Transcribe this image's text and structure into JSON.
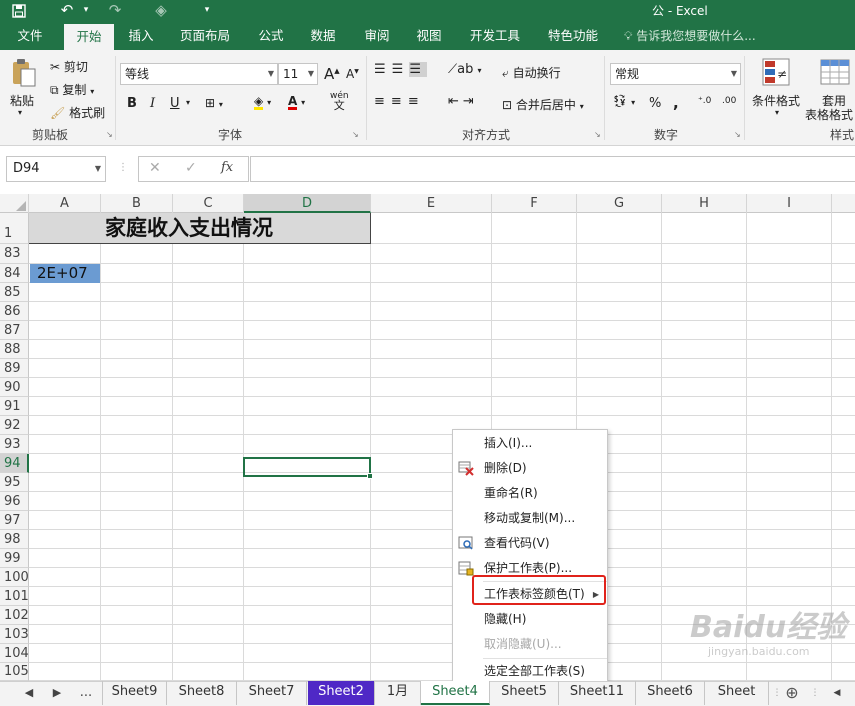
{
  "titlebar": {
    "title": "公 - Excel",
    "save_icon": "save-icon",
    "undo_icon": "undo-icon",
    "redo_icon": "redo-icon",
    "customize_icon": "customize-qat-icon"
  },
  "ribbon_tabs": [
    "文件",
    "开始",
    "插入",
    "页面布局",
    "公式",
    "数据",
    "审阅",
    "视图",
    "开发工具",
    "特色功能"
  ],
  "active_tab": "开始",
  "tell_me": "告诉我您想要做什么...",
  "clipboard": {
    "paste": "粘贴",
    "cut": "剪切",
    "copy": "复制",
    "format_painter": "格式刷",
    "label": "剪贴板"
  },
  "font": {
    "name": "等线",
    "size": "11",
    "label": "字体",
    "bold": "B",
    "italic": "I",
    "underline": "U",
    "grow": "A",
    "shrink": "A",
    "phonetic": "wén"
  },
  "alignment": {
    "wrap": "自动换行",
    "merge": "合并后居中",
    "label": "对齐方式"
  },
  "number": {
    "format": "常规",
    "label": "数字",
    "percent": "%",
    "comma": ","
  },
  "styles": {
    "conditional": "条件格式",
    "table1": "套用",
    "table2": "表格格式",
    "label": "样式"
  },
  "formula_bar": {
    "name_box": "D94",
    "cancel": "✕",
    "enter": "✓",
    "fx": "fx",
    "value": ""
  },
  "columns": [
    "A",
    "B",
    "C",
    "D",
    "E",
    "F",
    "G",
    "H",
    "I"
  ],
  "selected_column": "D",
  "rows": [
    "1",
    "83",
    "84",
    "85",
    "86",
    "87",
    "88",
    "89",
    "90",
    "91",
    "92",
    "93",
    "94",
    "95",
    "96",
    "97",
    "98",
    "99",
    "100",
    "101",
    "102",
    "103",
    "104",
    "105"
  ],
  "selected_row": "94",
  "cells": {
    "title": "家庭收入支出情况",
    "a84": "2E+07"
  },
  "context_menu": [
    {
      "label": "插入(I)...",
      "icon": "",
      "disabled": false
    },
    {
      "label": "删除(D)",
      "icon": "delete-sheet-icon",
      "disabled": false
    },
    {
      "label": "重命名(R)",
      "icon": "",
      "disabled": false
    },
    {
      "label": "移动或复制(M)...",
      "icon": "",
      "disabled": false
    },
    {
      "label": "查看代码(V)",
      "icon": "view-code-icon",
      "disabled": false
    },
    {
      "label": "保护工作表(P)...",
      "icon": "protect-sheet-icon",
      "disabled": false
    },
    {
      "label": "工作表标签颜色(T)",
      "icon": "",
      "disabled": false,
      "submenu": true
    },
    {
      "label": "隐藏(H)",
      "icon": "",
      "disabled": false
    },
    {
      "label": "取消隐藏(U)...",
      "icon": "",
      "disabled": true
    },
    {
      "label": "选定全部工作表(S)",
      "icon": "",
      "disabled": false
    }
  ],
  "sheet_tabs": [
    {
      "label": "Sheet9",
      "state": "normal"
    },
    {
      "label": "Sheet8",
      "state": "normal"
    },
    {
      "label": "Sheet7",
      "state": "normal"
    },
    {
      "label": "Sheet2",
      "state": "colored"
    },
    {
      "label": "1月",
      "state": "normal"
    },
    {
      "label": "Sheet4",
      "state": "active"
    },
    {
      "label": "Sheet5",
      "state": "normal"
    },
    {
      "label": "Sheet11",
      "state": "normal"
    },
    {
      "label": "Sheet6",
      "state": "normal"
    },
    {
      "label": "Sheet",
      "state": "normal"
    }
  ],
  "sheet_nav": {
    "prev": "◀",
    "next": "▶",
    "more": "...",
    "add": "⊕"
  },
  "colors": {
    "excel_green": "#217346",
    "sheet2_tab": "#4f28c6",
    "highlight_box": "#e0231b",
    "a84_fill": "#6b9bd2"
  },
  "watermark": {
    "text": "Baidu经验",
    "sub": "jingyan.baidu.com"
  }
}
